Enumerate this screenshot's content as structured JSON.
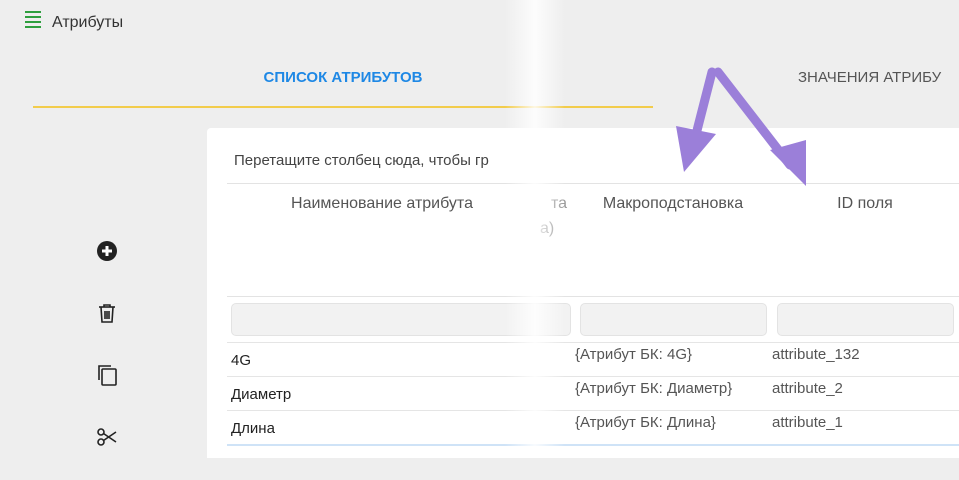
{
  "header": {
    "title": "Атрибуты",
    "icon": "list-icon"
  },
  "tabs": [
    {
      "label": "СПИСОК АТРИБУТОВ",
      "active": true
    },
    {
      "label": "ЗНАЧЕНИЯ АТРИБУ",
      "active": false
    }
  ],
  "sidebar": [
    {
      "name": "add-icon"
    },
    {
      "name": "trash-icon"
    },
    {
      "name": "copy-icon"
    },
    {
      "name": "scissors-icon"
    }
  ],
  "grid": {
    "group_hint": "Перетащите столбец сюда, чтобы гр",
    "columns": {
      "name": "Наименование атрибута",
      "partial_top": "та",
      "partial_bottom": "а)",
      "macro": "Макроподстановка",
      "field_id": "ID поля"
    },
    "rows": [
      {
        "name": "4G",
        "macro": "{Атрибут БК: 4G}",
        "field_id": "attribute_132"
      },
      {
        "name": "Диаметр",
        "macro": "{Атрибут БК: Диаметр}",
        "field_id": "attribute_2"
      },
      {
        "name": "Длина",
        "macro": "{Атрибут БК: Длина}",
        "field_id": "attribute_1"
      }
    ]
  },
  "colors": {
    "accent": "#1e88e5",
    "tab_underline": "#f2cc4b",
    "arrow": "#9b7fd9",
    "brand_green": "#2e9e3e"
  }
}
